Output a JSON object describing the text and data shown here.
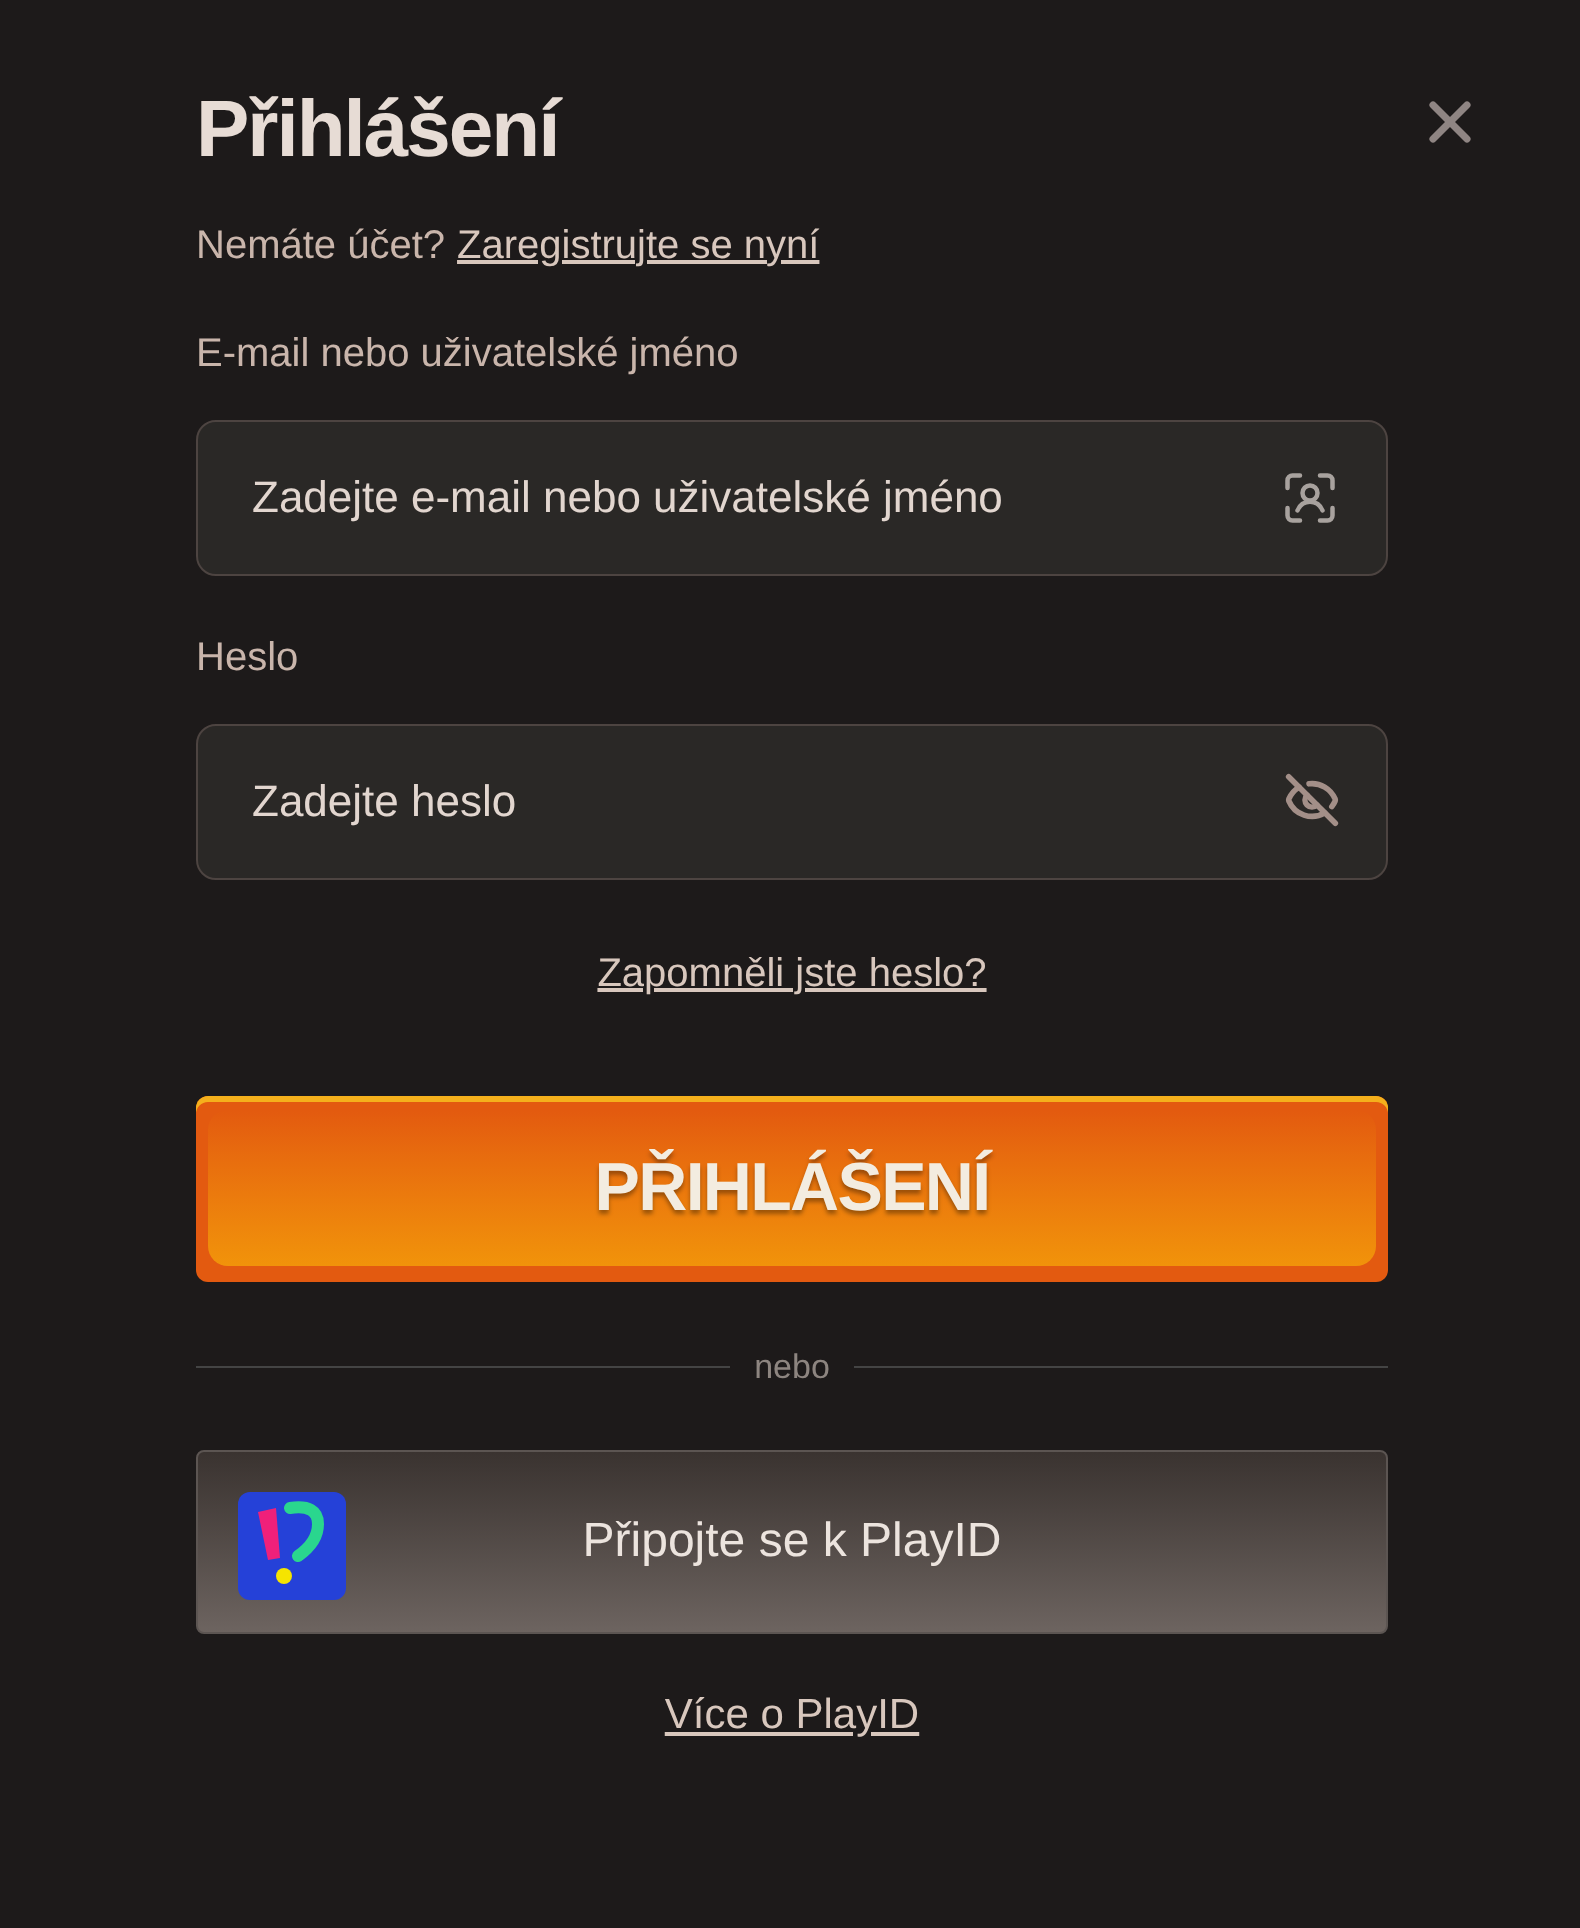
{
  "dialog": {
    "title": "Přihlášení"
  },
  "signup": {
    "text": "Nemáte účet?",
    "link": "Zaregistrujte se nyní"
  },
  "fields": [
    {
      "kind": "text",
      "label": "E-mail nebo uživatelské jméno",
      "placeholder": "Zadejte e-mail nebo uživatelské jméno"
    },
    {
      "kind": "password",
      "label": "Heslo",
      "placeholder": "Zadejte heslo"
    }
  ],
  "forgot_link": "Zapomněli jste heslo?",
  "submit_button": "PŘIHLÁŠENÍ",
  "divider": "nebo",
  "playid_button": "Připojte se k PlayID",
  "more_link": "Více o PlayID"
}
